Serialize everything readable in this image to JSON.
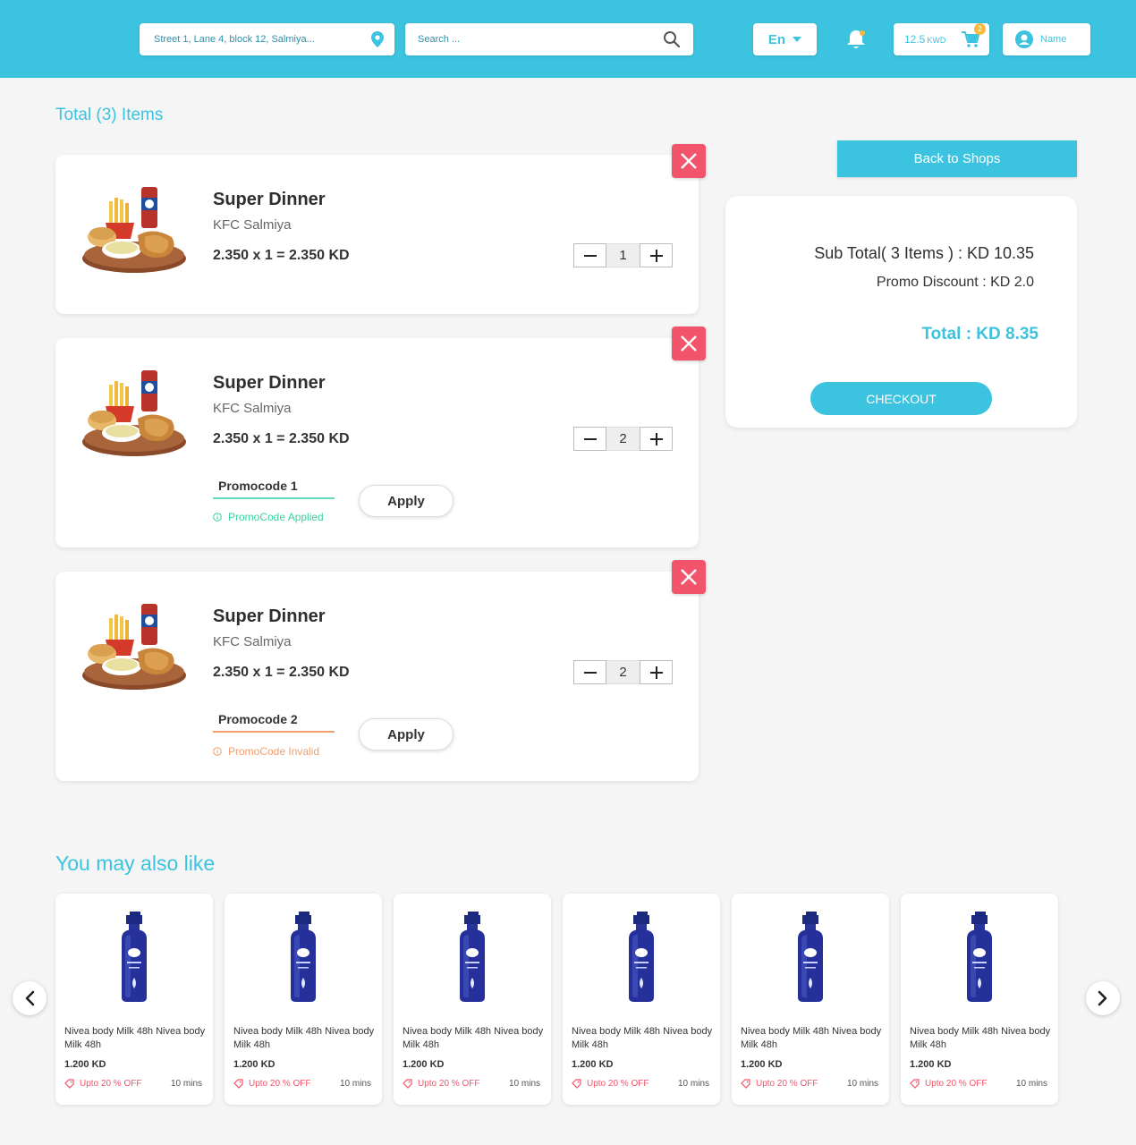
{
  "header": {
    "address": "Street 1, Lane 4, block 12, Salmiya...",
    "search_placeholder": "Search ...",
    "language": "En",
    "wallet_amount": "12.5",
    "wallet_currency": "KWD",
    "cart_count": "2",
    "user_name": "Name",
    "accent": "#3cc3e0"
  },
  "cart": {
    "total_title": "Total (3) Items",
    "items": [
      {
        "name": "Super Dinner",
        "shop": "KFC Salmiya",
        "price_line": "2.350 x 1 = 2.350 KD",
        "qty": "1"
      },
      {
        "name": "Super Dinner",
        "shop": "KFC Salmiya",
        "price_line": "2.350 x 1 = 2.350 KD",
        "qty": "2",
        "promo_code": "Promocode 1",
        "promo_status": "PromoCode Applied",
        "apply_label": "Apply"
      },
      {
        "name": "Super Dinner",
        "shop": "KFC Salmiya",
        "price_line": "2.350 x 1 = 2.350 KD",
        "qty": "2",
        "promo_code": "Promocode 2",
        "promo_status": "PromoCode Invalid",
        "apply_label": "Apply"
      }
    ]
  },
  "summary": {
    "back_label": "Back to Shops",
    "subtotal": "Sub Total( 3 Items ) : KD 10.35",
    "discount": "Promo Discount : KD 2.0",
    "total": "Total : KD 8.35",
    "checkout_label": "CHECKOUT"
  },
  "recommendations": {
    "title": "You may also like",
    "products": [
      {
        "name": "Nivea body Milk 48h Nivea body Milk 48h",
        "price": "1.200 KD",
        "offer": "Upto 20 % OFF",
        "time": "10 mins"
      },
      {
        "name": "Nivea body Milk 48h Nivea body Milk 48h",
        "price": "1.200 KD",
        "offer": "Upto 20 % OFF",
        "time": "10 mins"
      },
      {
        "name": "Nivea body Milk 48h Nivea body Milk 48h",
        "price": "1.200 KD",
        "offer": "Upto 20 % OFF",
        "time": "10 mins"
      },
      {
        "name": "Nivea body Milk 48h Nivea body Milk 48h",
        "price": "1.200 KD",
        "offer": "Upto 20 % OFF",
        "time": "10 mins"
      },
      {
        "name": "Nivea body Milk 48h Nivea body Milk 48h",
        "price": "1.200 KD",
        "offer": "Upto 20 % OFF",
        "time": "10 mins"
      },
      {
        "name": "Nivea body Milk 48h Nivea body Milk 48h",
        "price": "1.200 KD",
        "offer": "Upto 20 % OFF",
        "time": "10 mins"
      }
    ]
  }
}
